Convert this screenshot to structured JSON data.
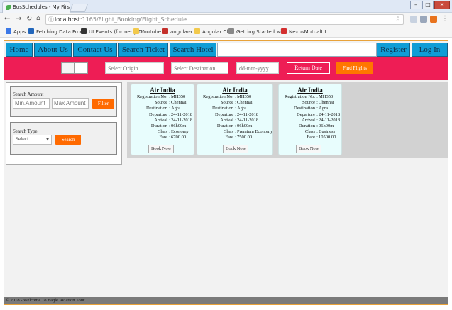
{
  "browser": {
    "tab_title": "BusSchedules - My First",
    "url_host": "localhost",
    "url_path": ":1165/Flight_Booking/Flight_Schedule",
    "bookmarks": [
      {
        "label": "Apps",
        "color": "#3b78e7"
      },
      {
        "label": "Fetching Data From",
        "color": "#2266bb"
      },
      {
        "label": "UI Events (formerly D",
        "color": "#333333"
      },
      {
        "label": "Youtube",
        "color": "#f2c94c"
      },
      {
        "label": "angular-cli",
        "color": "#c4302b"
      },
      {
        "label": "Angular Cli",
        "color": "#f2c94c"
      },
      {
        "label": "Getting Started with",
        "color": "#888888"
      },
      {
        "label": "NexusMutualUI",
        "color": "#d32f2f"
      }
    ]
  },
  "nav": {
    "home": "Home",
    "about": "About Us",
    "contact": "Contact Us",
    "search_ticket": "Search Ticket",
    "search_hotel": "Search Hotel",
    "register": "Register",
    "login": "Log In"
  },
  "search": {
    "origin_placeholder": "Select Origin",
    "destination_placeholder": "Select Destination",
    "date_placeholder": "dd-mm-yyyy",
    "return_label": "Return Date",
    "find_label": "Find Flights"
  },
  "filters": {
    "amount_title": "Search Amount",
    "min_placeholder": "Min.Amount",
    "max_placeholder": "Max Amount",
    "filter_label": "Filter",
    "type_title": "Search Type",
    "type_value": "Select",
    "search_label": "Search"
  },
  "flights": [
    {
      "airline": "Air India",
      "registration": "MH350",
      "source": "Chennai",
      "destination": "Agra",
      "departure": "24-11-2018",
      "arrival": "24-11-2018",
      "duration": "06h00m",
      "class": "Economy",
      "fare": "6700.00",
      "book": "Book Now"
    },
    {
      "airline": "Air India",
      "registration": "MH350",
      "source": "Chennai",
      "destination": "Agra",
      "departure": "24-11-2018",
      "arrival": "24-11-2018",
      "duration": "06h00m",
      "class": "Premium Economy",
      "fare": "7500.00",
      "book": "Book Now"
    },
    {
      "airline": "Air India",
      "registration": "MH350",
      "source": "Chennai",
      "destination": "Agra",
      "departure": "24-11-2018",
      "arrival": "24-11-2018",
      "duration": "06h00m",
      "class": "Business",
      "fare": "10500.00",
      "book": "Book Now"
    }
  ],
  "field_labels": {
    "registration": "Registration No.",
    "source": "Source",
    "destination": "Destination",
    "departure": "Departure",
    "arrival": "Arrival",
    "duration": "Duration",
    "class": "Class",
    "fare": "Fare"
  },
  "footer": "© 2018 - Welcome To Eagle Aviation Tour"
}
